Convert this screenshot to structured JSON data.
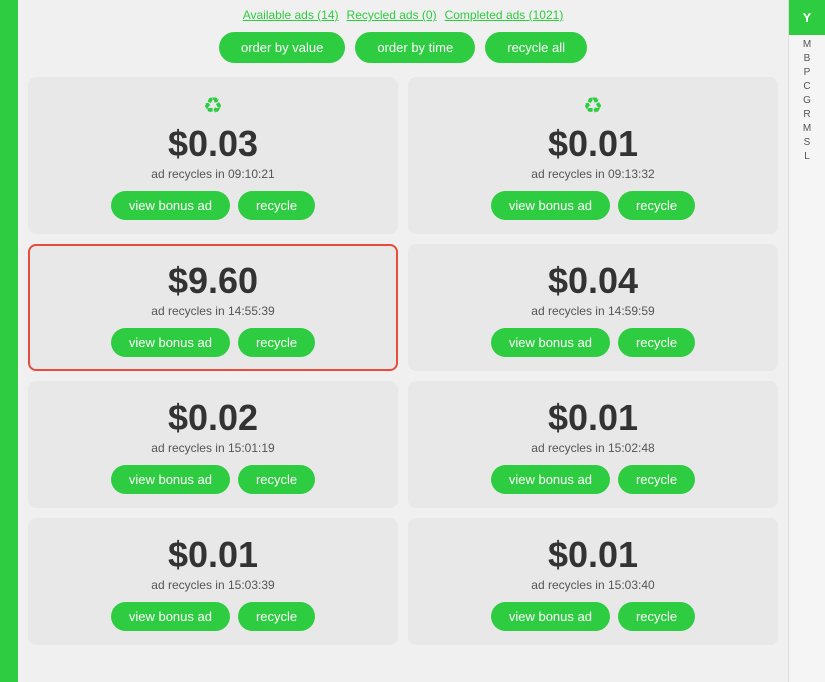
{
  "tabs": {
    "available": "Available ads (14)",
    "recycled": "Recycled ads (0)",
    "completed": "Completed ads (1021)"
  },
  "buttons": {
    "order_by_value": "order by value",
    "order_by_time": "order by time",
    "recycle_all": "recycle all",
    "view_bonus_ad": "view bonus ad",
    "recycle": "recycle"
  },
  "ads": [
    {
      "id": "ad-1",
      "amount": "$0.03",
      "timer": "ad recycles in 09:10:21",
      "has_icon": true,
      "highlighted": false
    },
    {
      "id": "ad-2",
      "amount": "$0.01",
      "timer": "ad recycles in 09:13:32",
      "has_icon": true,
      "highlighted": false
    },
    {
      "id": "ad-3",
      "amount": "$9.60",
      "timer": "ad recycles in 14:55:39",
      "has_icon": false,
      "highlighted": true
    },
    {
      "id": "ad-4",
      "amount": "$0.04",
      "timer": "ad recycles in 14:59:59",
      "has_icon": false,
      "highlighted": false
    },
    {
      "id": "ad-5",
      "amount": "$0.02",
      "timer": "ad recycles in 15:01:19",
      "has_icon": false,
      "highlighted": false
    },
    {
      "id": "ad-6",
      "amount": "$0.01",
      "timer": "ad recycles in 15:02:48",
      "has_icon": false,
      "highlighted": false
    },
    {
      "id": "ad-7",
      "amount": "$0.01",
      "timer": "ad recycles in 15:03:39",
      "has_icon": false,
      "highlighted": false
    },
    {
      "id": "ad-8",
      "amount": "$0.01",
      "timer": "ad recycles in 15:03:40",
      "has_icon": false,
      "highlighted": false
    }
  ],
  "right_panel": {
    "tab_label": "Y",
    "sidebar_letters": [
      "M",
      "B",
      "P",
      "C",
      "G",
      "R",
      "M",
      "S",
      "L"
    ]
  }
}
